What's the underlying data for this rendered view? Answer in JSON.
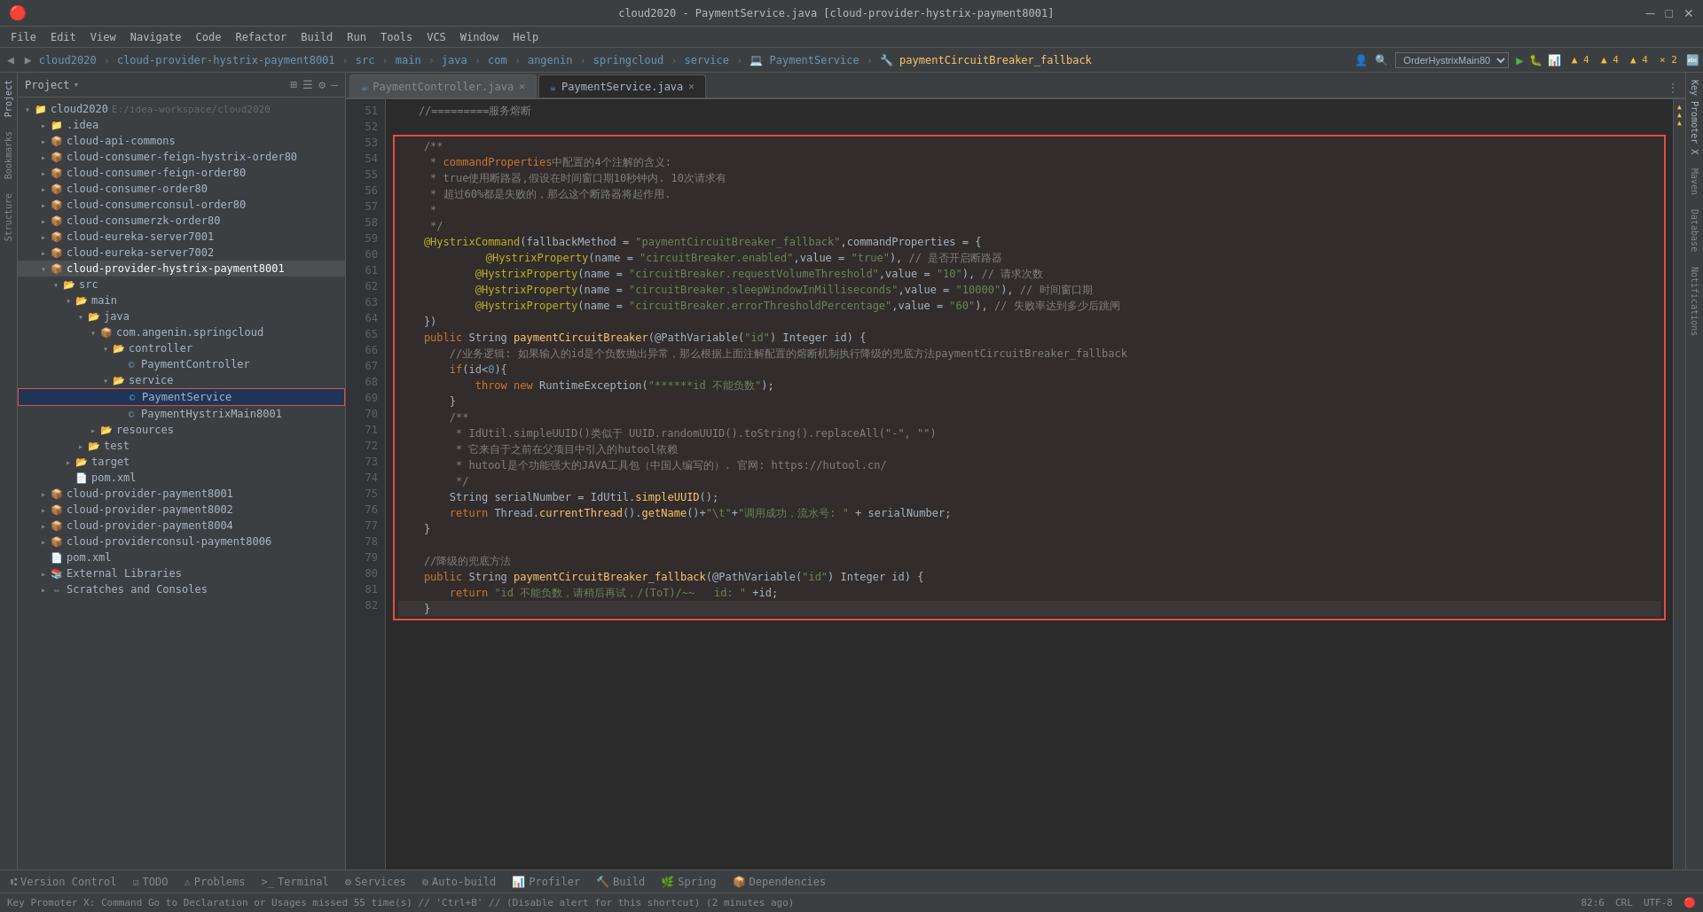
{
  "titleBar": {
    "title": "cloud2020 - PaymentService.java [cloud-provider-hystrix-payment8001]",
    "minBtn": "─",
    "maxBtn": "□",
    "closeBtn": "✕"
  },
  "menuBar": {
    "items": [
      "File",
      "Edit",
      "View",
      "Navigate",
      "Code",
      "Refactor",
      "Build",
      "Run",
      "Tools",
      "VCS",
      "Window",
      "Help"
    ]
  },
  "breadcrumb": {
    "items": [
      "cloud2020",
      "cloud-provider-hystrix-payment8001",
      "src",
      "main",
      "java",
      "com",
      "angenin",
      "springcloud",
      "service",
      "PaymentService",
      "paymentCircuitBreaker_fallback"
    ]
  },
  "tabs": {
    "items": [
      {
        "name": "PaymentController.java",
        "active": false,
        "modified": false
      },
      {
        "name": "PaymentService.java",
        "active": true,
        "modified": false
      }
    ]
  },
  "sidebar": {
    "title": "Project",
    "projectRoot": "cloud2020",
    "projectPath": "E:/idea-workspace/cloud2020"
  },
  "bottomTabs": {
    "items": [
      {
        "label": "Version Control",
        "icon": "⑆",
        "active": false
      },
      {
        "label": "TODO",
        "icon": "☑",
        "active": false
      },
      {
        "label": "Problems",
        "icon": "⚠",
        "active": false
      },
      {
        "label": "Terminal",
        "icon": ">_",
        "active": false
      },
      {
        "label": "Services",
        "icon": "⚙",
        "active": false
      },
      {
        "label": "Auto-build",
        "icon": "⚙",
        "active": false
      },
      {
        "label": "Profiler",
        "icon": "📊",
        "active": false
      },
      {
        "label": "Build",
        "icon": "🔨",
        "active": false
      },
      {
        "label": "Spring",
        "icon": "🌿",
        "active": false
      },
      {
        "label": "Dependencies",
        "icon": "📦",
        "active": false
      }
    ]
  },
  "statusBar": {
    "left": "Key Promoter X: Command Go to Declaration or Usages missed 55 time(s) // 'Ctrl+B' // (Disable alert for this shortcut) (2 minutes ago)",
    "position": "82:6",
    "encoding": "CRL",
    "warnings": "▲ 4  ▲ 4  ▲ 4  × 2"
  },
  "code": {
    "startLine": 51,
    "lines": [
      {
        "num": 51,
        "text": "    //=========服务熔断",
        "type": "comment"
      },
      {
        "num": 52,
        "text": "",
        "type": "normal"
      },
      {
        "num": 53,
        "text": "    /**",
        "type": "comment"
      },
      {
        "num": 54,
        "text": "     * commandProperties中配置的4个注解的含义:",
        "type": "comment"
      },
      {
        "num": 55,
        "text": "     * true使用断路器,假设在时间窗口期10秒钟内. 10次请求有",
        "type": "comment"
      },
      {
        "num": 56,
        "text": "     * 超过60%都是失败的，那么这个断路器将起作用.",
        "type": "comment"
      },
      {
        "num": 57,
        "text": "     *",
        "type": "comment"
      },
      {
        "num": 58,
        "text": "     */",
        "type": "comment"
      },
      {
        "num": 59,
        "text": "    @HystrixCommand(fallbackMethod = \"paymentCircuitBreaker_fallback\",commandProperties = {",
        "type": "annotation"
      },
      {
        "num": 60,
        "text": "            @HystrixProperty(name = \"circuitBreaker.enabled\",value = \"true\"), // 是否开启断路器",
        "type": "annotation"
      },
      {
        "num": 61,
        "text": "            @HystrixProperty(name = \"circuitBreaker.requestVolumeThreshold\",value = \"10\"), // 请求次数",
        "type": "annotation"
      },
      {
        "num": 62,
        "text": "            @HystrixProperty(name = \"circuitBreaker.sleepWindowInMilliseconds\",value = \"10000\"), // 时间窗口期",
        "type": "annotation"
      },
      {
        "num": 63,
        "text": "            @HystrixProperty(name = \"circuitBreaker.errorThresholdPercentage\",value = \"60\"), // 失败率达到多少后跳闸",
        "type": "annotation"
      },
      {
        "num": 64,
        "text": "    })",
        "type": "normal"
      },
      {
        "num": 65,
        "text": "    public String paymentCircuitBreaker(@PathVariable(\"id\") Integer id) {",
        "type": "code"
      },
      {
        "num": 66,
        "text": "        //业务逻辑: 如果输入的id是个负数抛出异常，那么根据上面注解配置的熔断机制执行降级的兜底方法paymentCircuitBreaker_fallback",
        "type": "comment"
      },
      {
        "num": 67,
        "text": "        if(id<0){",
        "type": "code"
      },
      {
        "num": 68,
        "text": "            throw new RuntimeException(\"******id 不能负数\");",
        "type": "code"
      },
      {
        "num": 69,
        "text": "        }",
        "type": "code"
      },
      {
        "num": 70,
        "text": "        /**",
        "type": "comment"
      },
      {
        "num": 71,
        "text": "         * IdUtil.simpleUUID()类似于 UUID.randomUUID().toString().replaceAll(\"-\", \"\")",
        "type": "comment"
      },
      {
        "num": 72,
        "text": "         * 它来自于之前在父项目中引入的hutool依赖",
        "type": "comment"
      },
      {
        "num": 73,
        "text": "         * hutool是个功能强大的JAVA工具包（中国人编写的）. 官网: https://hutool.cn/",
        "type": "comment"
      },
      {
        "num": 74,
        "text": "         */",
        "type": "comment"
      },
      {
        "num": 75,
        "text": "        String serialNumber = IdUtil.simpleUUID();",
        "type": "code"
      },
      {
        "num": 76,
        "text": "        return Thread.currentThread().getName()+\"\\t\"+\"调用成功，流水号: \" + serialNumber;",
        "type": "code"
      },
      {
        "num": 77,
        "text": "    }",
        "type": "code"
      },
      {
        "num": 78,
        "text": "",
        "type": "normal"
      },
      {
        "num": 79,
        "text": "    //降级的兜底方法",
        "type": "comment"
      },
      {
        "num": 80,
        "text": "    public String paymentCircuitBreaker_fallback(@PathVariable(\"id\") Integer id) {",
        "type": "code"
      },
      {
        "num": 81,
        "text": "        return \"id 不能负数，请稍后再试，/(ToT)/~~   id: \" +id;",
        "type": "code"
      },
      {
        "num": 82,
        "text": "    }",
        "type": "code"
      }
    ]
  },
  "treeItems": [
    {
      "level": 0,
      "type": "root",
      "label": "cloud2020",
      "expanded": true,
      "path": "E:/idea-workspace/cloud2020"
    },
    {
      "level": 1,
      "type": "folder",
      "label": ".idea",
      "expanded": false
    },
    {
      "level": 1,
      "type": "module",
      "label": "cloud-api-commons",
      "expanded": false
    },
    {
      "level": 1,
      "type": "module",
      "label": "cloud-consumer-feign-hystrix-order80",
      "expanded": false
    },
    {
      "level": 1,
      "type": "module",
      "label": "cloud-consumer-feign-order80",
      "expanded": false
    },
    {
      "level": 1,
      "type": "module",
      "label": "cloud-consumer-order80",
      "expanded": false
    },
    {
      "level": 1,
      "type": "module",
      "label": "cloud-consumerconsul-order80",
      "expanded": false
    },
    {
      "level": 1,
      "type": "module",
      "label": "cloud-consumerzk-order80",
      "expanded": false
    },
    {
      "level": 1,
      "type": "module",
      "label": "cloud-eureka-server7001",
      "expanded": false
    },
    {
      "level": 1,
      "type": "module",
      "label": "cloud-eureka-server7002",
      "expanded": false
    },
    {
      "level": 1,
      "type": "module",
      "label": "cloud-provider-hystrix-payment8001",
      "expanded": true,
      "selected": true
    },
    {
      "level": 2,
      "type": "src",
      "label": "src",
      "expanded": true
    },
    {
      "level": 3,
      "type": "folder",
      "label": "main",
      "expanded": true
    },
    {
      "level": 4,
      "type": "folder",
      "label": "java",
      "expanded": true
    },
    {
      "level": 5,
      "type": "package",
      "label": "com.angenin.springcloud",
      "expanded": true
    },
    {
      "level": 6,
      "type": "folder",
      "label": "controller",
      "expanded": true
    },
    {
      "level": 7,
      "type": "java",
      "label": "PaymentController",
      "expanded": false
    },
    {
      "level": 6,
      "type": "folder",
      "label": "service",
      "expanded": true
    },
    {
      "level": 7,
      "type": "java",
      "label": "PaymentService",
      "expanded": false,
      "highlighted": true
    },
    {
      "level": 7,
      "type": "java",
      "label": "PaymentHystrixMain8001",
      "expanded": false
    },
    {
      "level": 4,
      "type": "folder",
      "label": "resources",
      "expanded": false
    },
    {
      "level": 3,
      "type": "folder",
      "label": "test",
      "expanded": false
    },
    {
      "level": 2,
      "type": "folder",
      "label": "target",
      "expanded": false
    },
    {
      "level": 2,
      "type": "xml",
      "label": "pom.xml",
      "expanded": false
    },
    {
      "level": 1,
      "type": "module",
      "label": "cloud-provider-payment8001",
      "expanded": false
    },
    {
      "level": 1,
      "type": "module",
      "label": "cloud-provider-payment8002",
      "expanded": false
    },
    {
      "level": 1,
      "type": "module",
      "label": "cloud-provider-payment8004",
      "expanded": false
    },
    {
      "level": 1,
      "type": "module",
      "label": "cloud-providerconsul-payment8006",
      "expanded": false
    },
    {
      "level": 2,
      "type": "xml",
      "label": "pom.xml",
      "expanded": false
    },
    {
      "level": 1,
      "type": "lib",
      "label": "External Libraries",
      "expanded": false
    },
    {
      "level": 1,
      "type": "scratch",
      "label": "Scratches and Consoles",
      "expanded": false
    }
  ],
  "rightPanel": {
    "items": [
      "Key Promoter X",
      "Maven",
      "Database",
      "Notifications"
    ]
  },
  "toolbar": {
    "runConfig": "OrderHystrixMain80",
    "warningsText": "▲ 4  ▲ 4  ▲ 4  × 2"
  }
}
